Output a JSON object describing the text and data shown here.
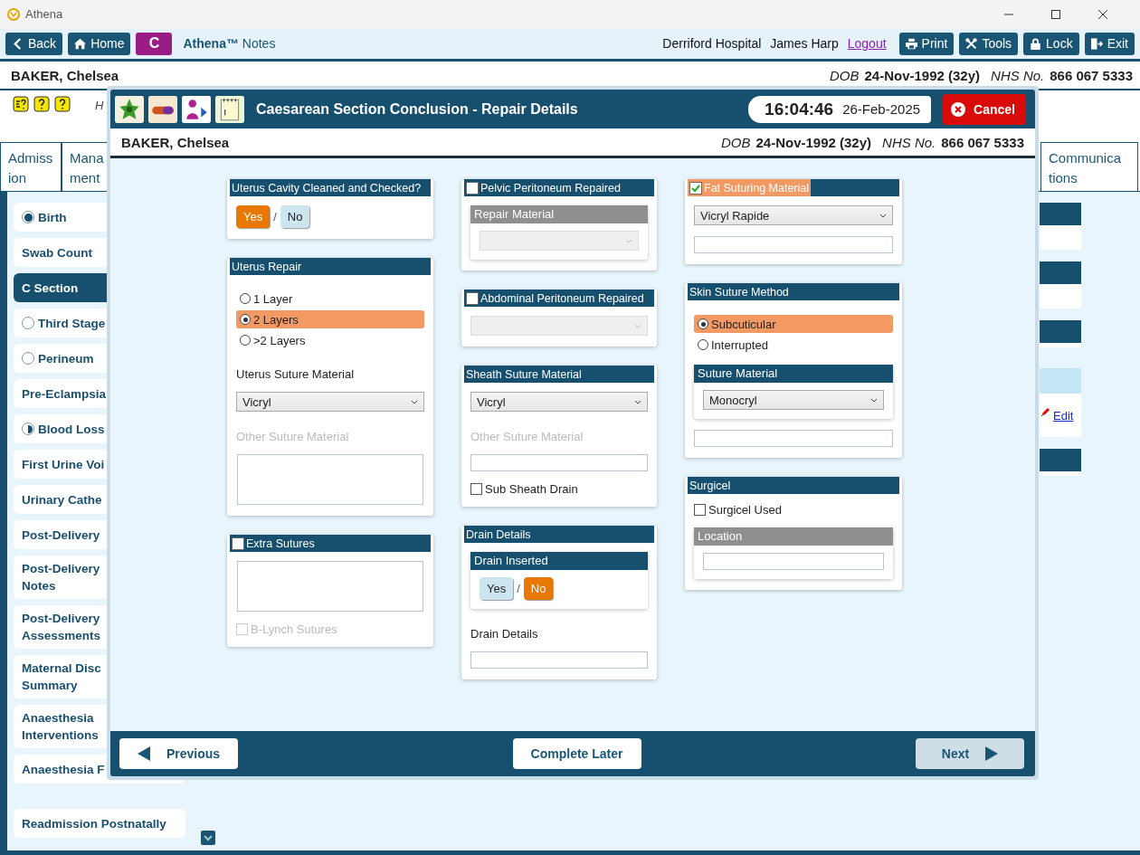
{
  "window": {
    "title": "Athena"
  },
  "toolbar": {
    "nav_buttons": [
      "Back",
      "Home"
    ],
    "app_badge": "C",
    "app_title": "**Athena™** Notes",
    "hospital": "Derriford Hospital",
    "user": "James Harp",
    "logout_link": "Logout",
    "tool_buttons": [
      "Print",
      "Tools",
      "Lock",
      "Exit"
    ]
  },
  "patient": {
    "name": "BAKER, Chelsea",
    "dob_label": "DOB",
    "dob": "24-Nov-1992 (32y)",
    "nhs_label": "NHS No.",
    "nhs": "866 067 5333"
  },
  "hint_text": "H",
  "tabs": [
    {
      "lines": [
        "Admiss",
        "ion"
      ]
    },
    {
      "lines": [
        "Mana",
        "ment"
      ]
    },
    {
      "lines": [
        "Communica",
        "tions"
      ]
    }
  ],
  "sidebar": {
    "items": [
      {
        "lines": [
          "Birth"
        ],
        "kind": "complete",
        "selected": false
      },
      {
        "lines": [
          "Swab Count"
        ],
        "kind": "plain",
        "selected": false
      },
      {
        "lines": [
          "C Section"
        ],
        "kind": "plain",
        "selected": true
      },
      {
        "lines": [
          "Third Stage"
        ],
        "kind": "empty",
        "selected": false
      },
      {
        "lines": [
          "Perineum"
        ],
        "kind": "empty",
        "selected": false
      },
      {
        "lines": [
          "Pre-Eclampsia"
        ],
        "kind": "plain",
        "selected": false
      },
      {
        "lines": [
          "Blood Loss"
        ],
        "kind": "partial",
        "selected": false
      },
      {
        "lines": [
          "First Urine Voi"
        ],
        "kind": "plain",
        "selected": false
      },
      {
        "lines": [
          "Urinary Cathe"
        ],
        "kind": "plain",
        "selected": false
      },
      {
        "lines": [
          "Post-Delivery"
        ],
        "kind": "plain",
        "selected": false
      },
      {
        "lines": [
          "Post-Delivery",
          "Notes"
        ],
        "kind": "plain",
        "selected": false
      },
      {
        "lines": [
          "Post-Delivery",
          "Assessments"
        ],
        "kind": "plain",
        "selected": false
      },
      {
        "lines": [
          "Maternal Disc",
          "Summary"
        ],
        "kind": "plain",
        "selected": false
      },
      {
        "lines": [
          "Anaesthesia",
          "Interventions"
        ],
        "kind": "plain",
        "selected": false
      },
      {
        "lines": [
          "Anaesthesia F"
        ],
        "kind": "plain",
        "selected": false
      },
      {
        "lines": [
          "Readmission Postnatally"
        ],
        "kind": "plain",
        "selected": false
      }
    ]
  },
  "right_panel": {
    "edit_link": "Edit"
  },
  "modal": {
    "title": "Caesarean Section Conclusion - Repair Details",
    "time": "16:04:46",
    "date": "26-Feb-2025",
    "cancel": "Cancel",
    "patient": {
      "name": "BAKER, Chelsea",
      "dob_label": "DOB",
      "dob": "24-Nov-1992 (32y)",
      "nhs_label": "NHS No.",
      "nhs": "866 067 5333"
    },
    "columns": [
      [
        {
          "title": "Uterus Cavity Cleaned and Checked?",
          "items": [
            {
              "kind": "yesno",
              "separator": "/",
              "options": [
                {
                  "label": "Yes",
                  "selected": true
                },
                {
                  "label": "No",
                  "selected": false
                }
              ]
            }
          ]
        },
        {
          "title": "Uterus Repair",
          "items": [
            {
              "kind": "radios",
              "options": [
                {
                  "label": "1 Layer",
                  "selected": false
                },
                {
                  "label": "2 Layers",
                  "selected": true
                },
                {
                  "label": ">2 Layers",
                  "selected": false
                }
              ]
            },
            {
              "kind": "label",
              "text": "Uterus Suture Material",
              "disabled": false
            },
            {
              "kind": "select",
              "value": "Vicryl",
              "disabled": false
            },
            {
              "kind": "label",
              "text": "Other Suture Material",
              "disabled": true
            },
            {
              "kind": "textarea"
            }
          ]
        },
        {
          "title": "Extra Sutures",
          "checked": false,
          "items": [
            {
              "kind": "textarea"
            },
            {
              "kind": "checkbox",
              "label": "B-Lynch Sutures",
              "checked": false,
              "disabled": true
            }
          ]
        }
      ],
      [
        {
          "title": "Pelvic Peritoneum Repaired",
          "checked": false,
          "items": [
            {
              "kind": "subcard",
              "title": "Repair Material",
              "disabled": true,
              "items": [
                {
                  "kind": "select",
                  "disabled": true
                }
              ]
            }
          ]
        },
        {
          "title": "Abdominal Peritoneum Repaired",
          "checked": false,
          "items": [
            {
              "kind": "select",
              "disabled": true
            }
          ]
        },
        {
          "title": "Sheath Suture Material",
          "items": [
            {
              "kind": "select",
              "value": "Vicryl",
              "disabled": false
            },
            {
              "kind": "label",
              "text": "Other Suture Material",
              "disabled": true
            },
            {
              "kind": "input"
            },
            {
              "kind": "checkbox",
              "label": "Sub Sheath Drain",
              "checked": false,
              "disabled": false
            }
          ]
        },
        {
          "title": "Drain Details",
          "items": [
            {
              "kind": "subcard",
              "title": "Drain Inserted",
              "disabled": false,
              "items": [
                {
                  "kind": "yesno",
                  "separator": "/",
                  "options": [
                    {
                      "label": "Yes",
                      "selected": false
                    },
                    {
                      "label": "No",
                      "selected": true
                    }
                  ]
                }
              ]
            },
            {
              "kind": "label",
              "text": "Drain Details",
              "disabled": false
            },
            {
              "kind": "input"
            }
          ]
        }
      ],
      [
        {
          "title": "Fat Suturing Material",
          "checked": true,
          "items": [
            {
              "kind": "select",
              "value": "Vicryl Rapide",
              "disabled": false
            },
            {
              "kind": "input"
            }
          ]
        },
        {
          "title": "Skin Suture Method",
          "items": [
            {
              "kind": "radios",
              "options": [
                {
                  "label": "Subcuticular",
                  "selected": true
                },
                {
                  "label": "Interrupted",
                  "selected": false
                }
              ]
            },
            {
              "kind": "subcard",
              "title": "Suture Material",
              "disabled": false,
              "items": [
                {
                  "kind": "select",
                  "value": "Monocryl",
                  "disabled": false
                }
              ]
            },
            {
              "kind": "input"
            }
          ]
        },
        {
          "title": "Surgicel",
          "items": [
            {
              "kind": "checkbox",
              "label": "Surgicel Used",
              "checked": false,
              "disabled": false
            },
            {
              "kind": "subcard",
              "title": "Location",
              "disabled": true,
              "items": [
                {
                  "kind": "input"
                }
              ]
            }
          ]
        }
      ]
    ],
    "footer": {
      "previous": "Previous",
      "complete_later": "Complete Later",
      "next": "Next",
      "next_disabled": true
    }
  }
}
